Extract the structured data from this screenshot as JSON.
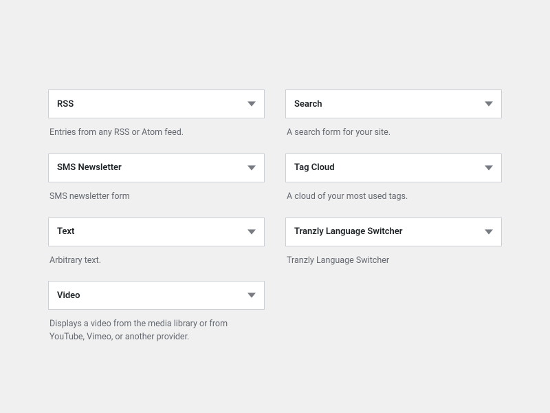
{
  "widgets": {
    "left": [
      {
        "title": "RSS",
        "description": "Entries from any RSS or Atom feed."
      },
      {
        "title": "SMS Newsletter",
        "description": "SMS newsletter form"
      },
      {
        "title": "Text",
        "description": "Arbitrary text."
      },
      {
        "title": "Video",
        "description": "Displays a video from the media library or from YouTube, Vimeo, or another provider."
      }
    ],
    "right": [
      {
        "title": "Search",
        "description": "A search form for your site."
      },
      {
        "title": "Tag Cloud",
        "description": "A cloud of your most used tags."
      },
      {
        "title": "Tranzly Language Switcher",
        "description": "Tranzly Language Switcher"
      }
    ]
  }
}
